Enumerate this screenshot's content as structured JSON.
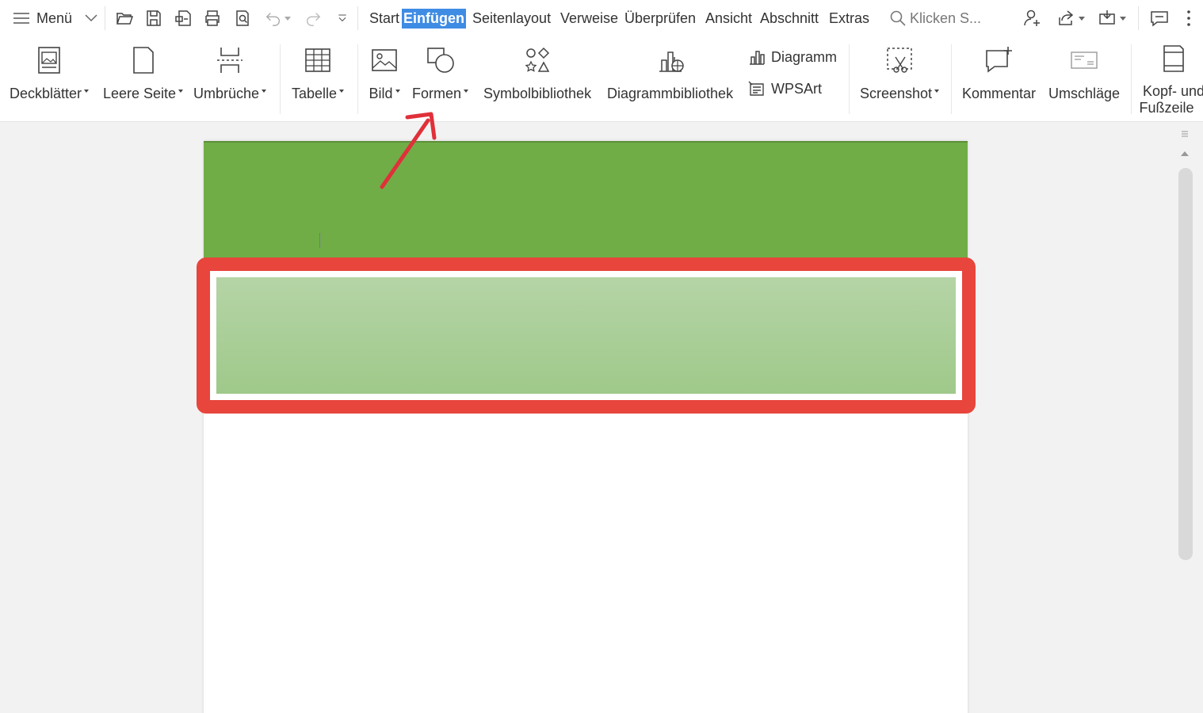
{
  "titlebar": {
    "menu_label": "Menü",
    "search_placeholder": "Klicken S..."
  },
  "tabs": [
    {
      "label": "Start",
      "active": false
    },
    {
      "label": "Einfügen",
      "active": true
    },
    {
      "label": "Seitenlayout",
      "active": false
    },
    {
      "label": "Verweise",
      "active": false
    },
    {
      "label": "Überprüfen",
      "active": false
    },
    {
      "label": "Ansicht",
      "active": false
    },
    {
      "label": "Abschnitt",
      "active": false
    },
    {
      "label": "Extras",
      "active": false
    }
  ],
  "ribbon": {
    "cover_pages": "Deckblätter",
    "blank_page": "Leere Seite",
    "breaks": "Umbrüche",
    "table": "Tabelle",
    "picture": "Bild",
    "shapes": "Formen",
    "symbol_library": "Symbolbibliothek",
    "chart_library": "Diagrammbibliothek",
    "chart": "Diagramm",
    "wpsart": "WPSArt",
    "screenshot": "Screenshot",
    "comment": "Kommentar",
    "envelopes": "Umschläge",
    "header_footer_line1": "Kopf- und",
    "header_footer_line2": "Fußzeile"
  },
  "colors": {
    "accent_tab": "#3f8ce4",
    "shape_green": "#70ad47",
    "band_light_green": "#a8cd96",
    "highlight_red": "#e8453c",
    "arrow_red": "#e0303a"
  }
}
